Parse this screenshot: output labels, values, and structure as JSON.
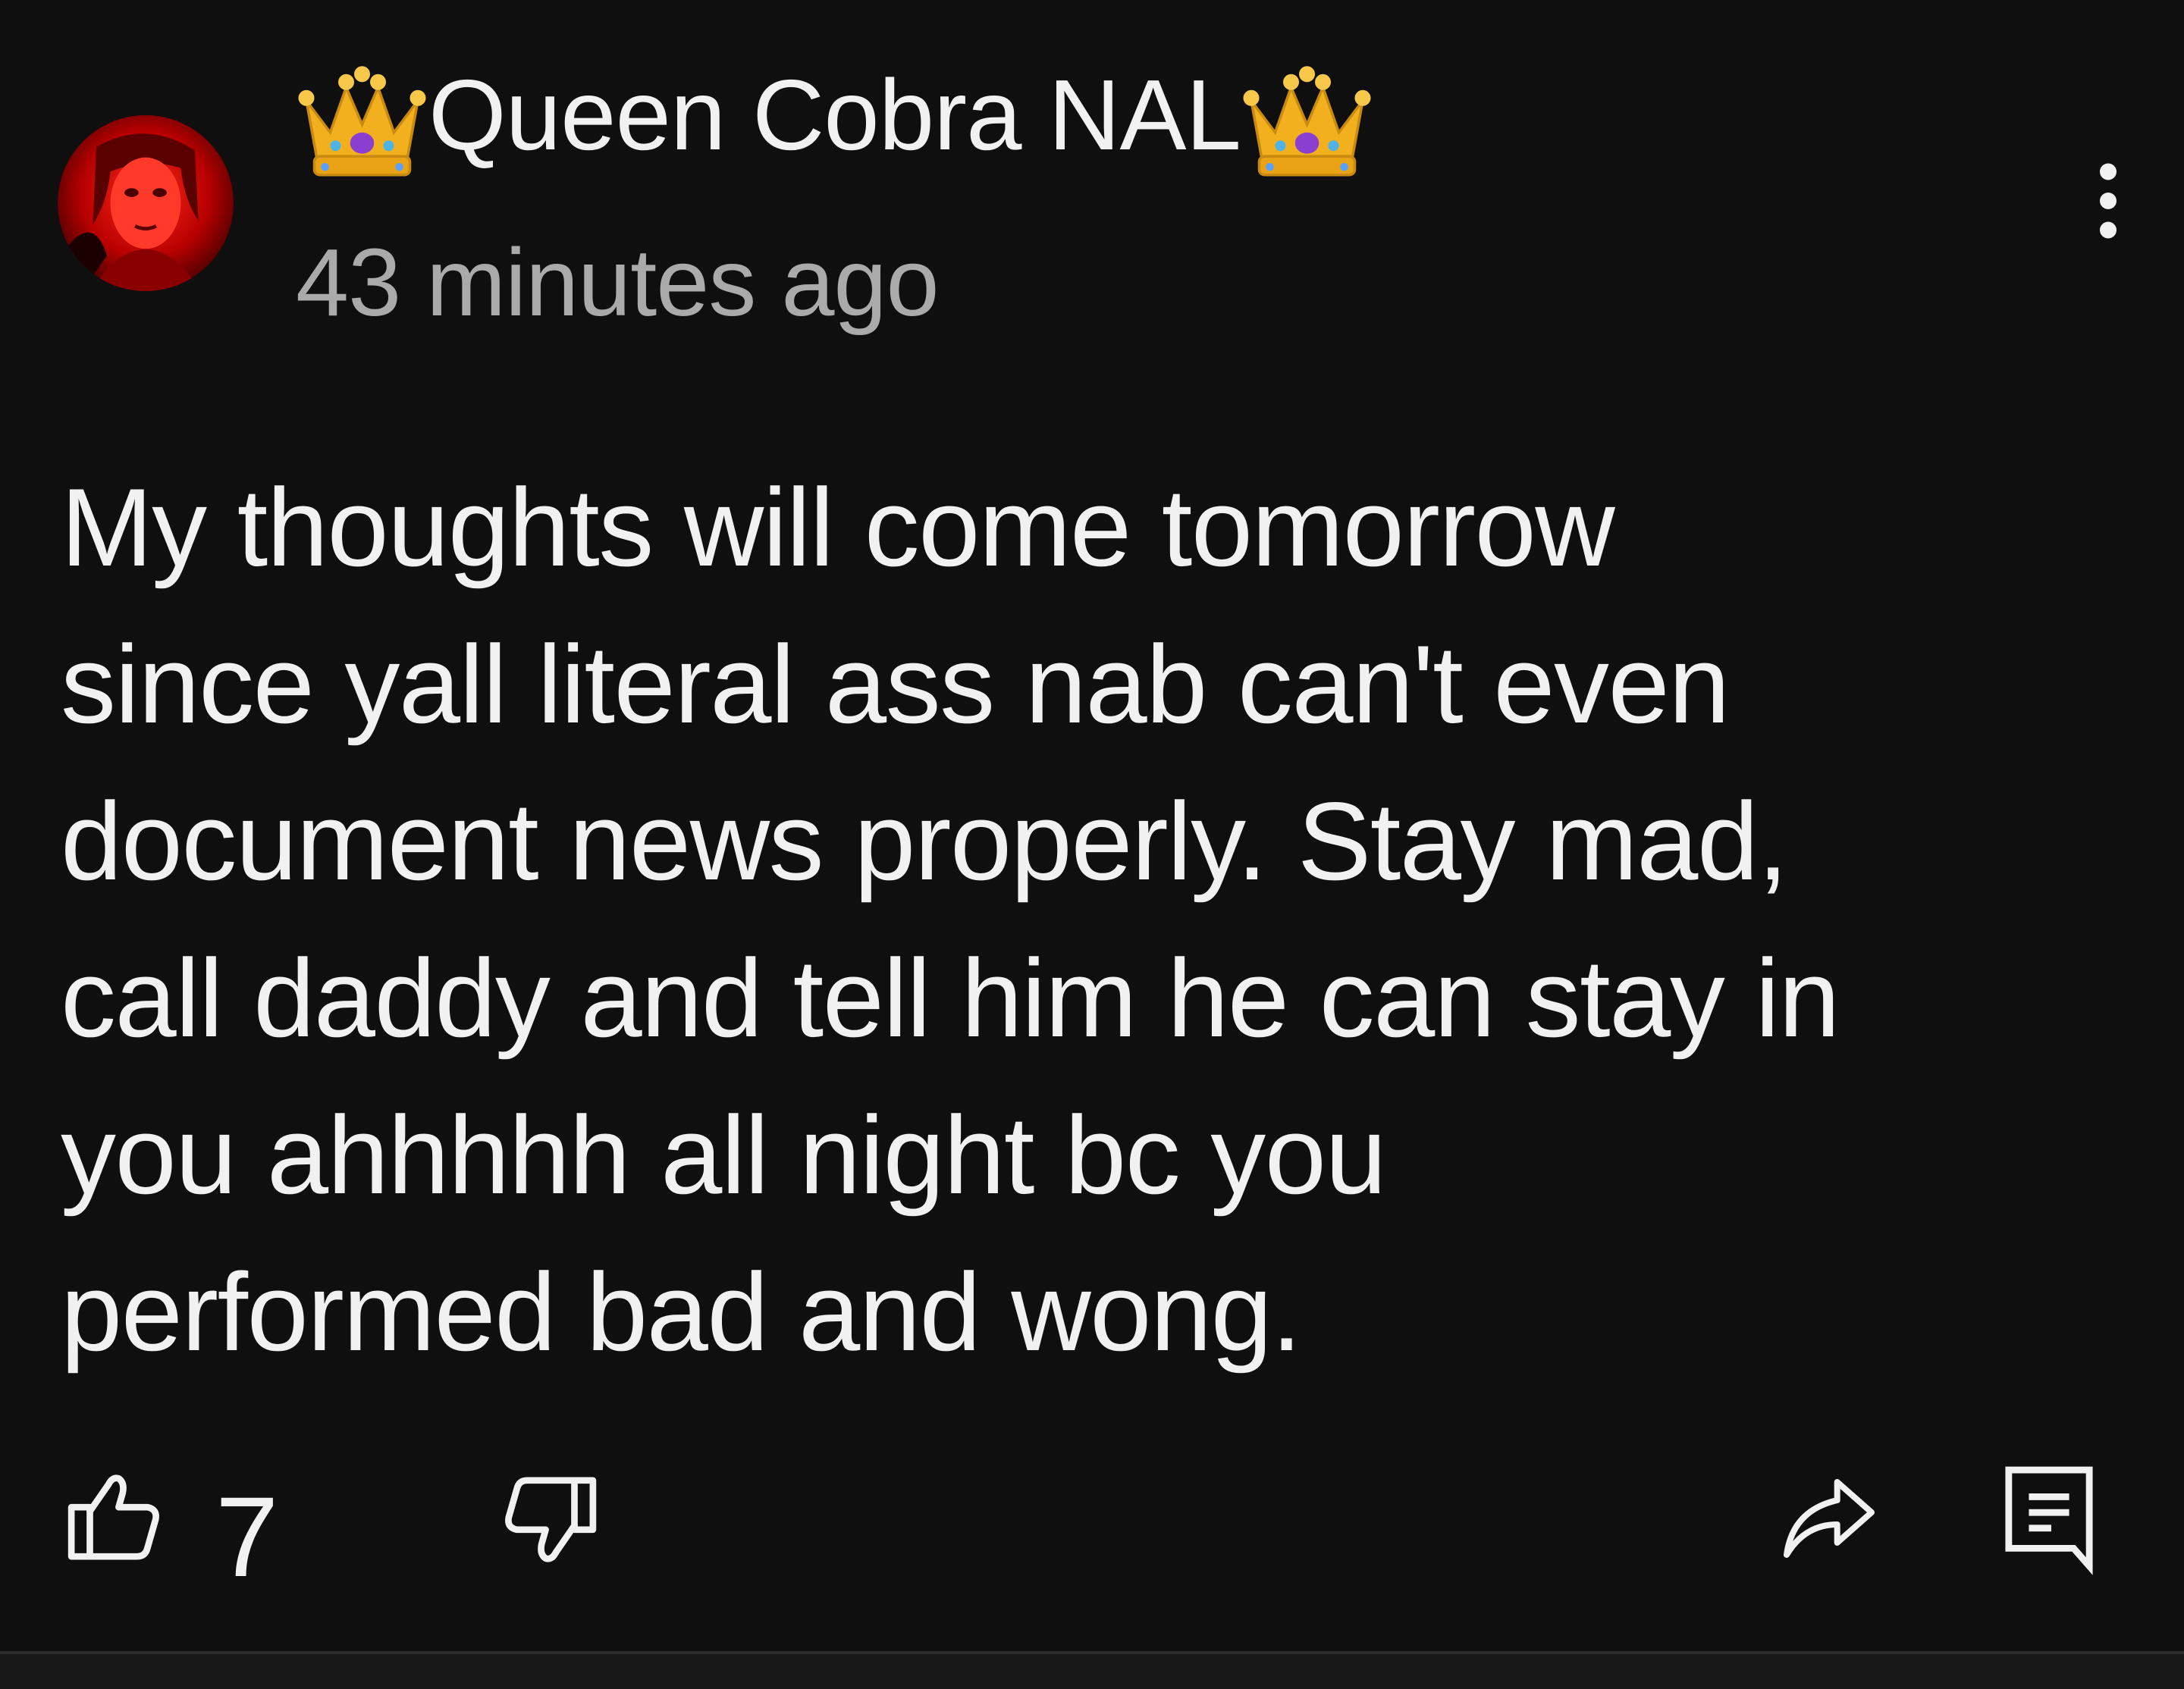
{
  "comment": {
    "author": {
      "name": "Queen Cobra NAL",
      "prefix_emoji": "crown-icon",
      "suffix_emoji": "crown-icon"
    },
    "timestamp": "43 minutes ago",
    "text": "My thoughts will come tomorrow\nsince yall literal ass nab can't even\ndocument news properly. Stay mad,\ncall daddy and tell him he can stay in\nyou ahhhhh all night bc you\nperformed bad and wong.",
    "like_count": "7"
  },
  "icons": {
    "more": "more-vert-icon",
    "like": "thumb-up-icon",
    "dislike": "thumb-down-icon",
    "share": "share-arrow-icon",
    "reply": "reply-comment-icon"
  },
  "colors": {
    "background": "#0f0f0f",
    "primary_text": "#f1f1f1",
    "secondary_text": "#aaaaaa",
    "crown_gold": "#f2b01e",
    "avatar_red": "#d10a0a"
  }
}
